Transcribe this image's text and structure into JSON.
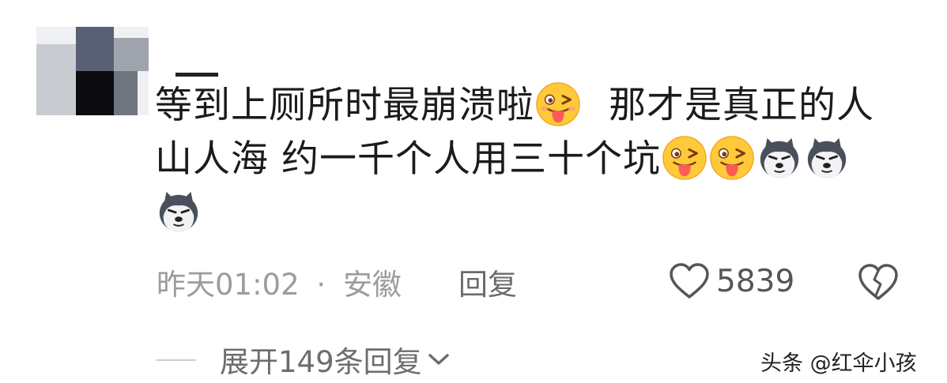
{
  "comment": {
    "line1": "等到上厕所时最崩溃啦",
    "line1b": "那才是真正的人",
    "line2": "山人海 约一千个人用三十个坑"
  },
  "emojis": {
    "tongue": "tongue-wink-emoji",
    "husky": "husky-dog-emoji"
  },
  "meta": {
    "time": "昨天01:02",
    "sep": "·",
    "location": "安徽",
    "reply": "回复"
  },
  "likes": {
    "count": "5839"
  },
  "expand": {
    "label": "展开149条回复"
  },
  "watermark": {
    "text": "头条 @红伞小孩"
  }
}
